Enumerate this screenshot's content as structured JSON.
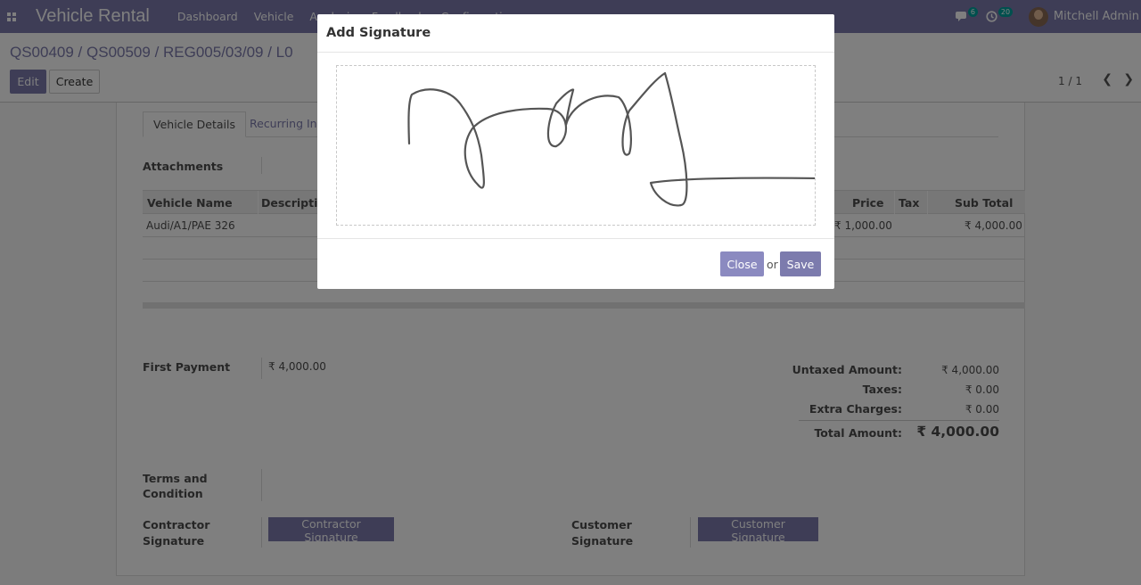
{
  "navbar": {
    "app_title": "Vehicle Rental",
    "menu": [
      "Dashboard",
      "Vehicle",
      "Analysis",
      "Feedback",
      "Configuration"
    ],
    "messages_count": "6",
    "activities_count": "20",
    "user_name": "Mitchell Admin"
  },
  "control_panel": {
    "breadcrumb": "QS00409 / QS00509 / REG005/03/09 / L0",
    "edit_label": "Edit",
    "create_label": "Create",
    "pager": "1 / 1"
  },
  "form": {
    "tabs": [
      "Vehicle Details",
      "Recurring Inv"
    ],
    "attachments_label": "Attachments",
    "table": {
      "headers": [
        "Vehicle Name",
        "Description",
        "Price",
        "Tax",
        "Sub Total"
      ],
      "rows": [
        {
          "vehicle": "Audi/A1/PAE 326",
          "price": "₹ 1,000.00",
          "subtotal": "₹ 4,000.00"
        }
      ]
    },
    "first_payment_label": "First Payment",
    "first_payment_value": "₹ 4,000.00",
    "totals": {
      "untaxed_label": "Untaxed Amount:",
      "untaxed_value": "₹ 4,000.00",
      "taxes_label": "Taxes:",
      "taxes_value": "₹ 0.00",
      "extra_label": "Extra Charges:",
      "extra_value": "₹ 0.00",
      "total_label": "Total Amount:",
      "total_value": "₹ 4,000.00"
    },
    "terms_label_1": "Terms and",
    "terms_label_2": "Condition",
    "contractor_label_1": "Contractor",
    "contractor_label_2": "Signature",
    "contractor_button": "Contractor Signature",
    "customer_label_1": "Customer",
    "customer_label_2": "Signature",
    "customer_button": "Customer Signature"
  },
  "modal": {
    "title": "Add Signature",
    "close_label": "Close",
    "or_text": "or",
    "save_label": "Save"
  }
}
